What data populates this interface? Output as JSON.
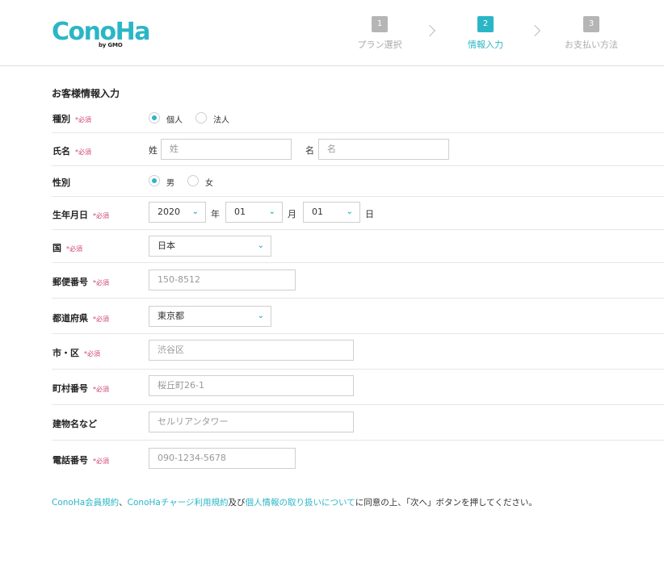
{
  "header": {
    "logo_text": "ConoHa",
    "logo_sub": "by GMO",
    "steps": [
      {
        "num": "1",
        "label": "プラン選択"
      },
      {
        "num": "2",
        "label": "情報入力"
      },
      {
        "num": "3",
        "label": "お支払い方法"
      }
    ],
    "active_step": 2
  },
  "form": {
    "title": "お客様情報入力",
    "required_mark": "*必須",
    "type": {
      "label": "種別",
      "options": [
        "個人",
        "法人"
      ],
      "selected": "個人"
    },
    "name": {
      "label": "氏名",
      "last_label": "姓",
      "last_placeholder": "姓",
      "first_label": "名",
      "first_placeholder": "名"
    },
    "gender": {
      "label": "性別",
      "options": [
        "男",
        "女"
      ],
      "selected": "男"
    },
    "birthdate": {
      "label": "生年月日",
      "year": "2020",
      "year_unit": "年",
      "month": "01",
      "month_unit": "月",
      "day": "01",
      "day_unit": "日"
    },
    "country": {
      "label": "国",
      "value": "日本"
    },
    "postal": {
      "label": "郵便番号",
      "placeholder": "150-8512"
    },
    "prefecture": {
      "label": "都道府県",
      "value": "東京都"
    },
    "city": {
      "label": "市・区",
      "placeholder": "渋谷区"
    },
    "town": {
      "label": "町村番号",
      "placeholder": "桜丘町26-1"
    },
    "building": {
      "label": "建物名など",
      "placeholder": "セルリアンタワー"
    },
    "phone": {
      "label": "電話番号",
      "placeholder": "090-1234-5678"
    }
  },
  "footer": {
    "link_terms": "ConoHa会員規約",
    "sep1": "、",
    "link_charge": "ConoHaチャージ利用規約",
    "and": "及び",
    "link_privacy": "個人情報の取り扱いについて",
    "tail": "に同意の上、「次へ」ボタンを押してください。"
  },
  "colors": {
    "accent": "#2bb6c6",
    "required": "#d0436e",
    "inactive_step": "#b5b5b5"
  }
}
